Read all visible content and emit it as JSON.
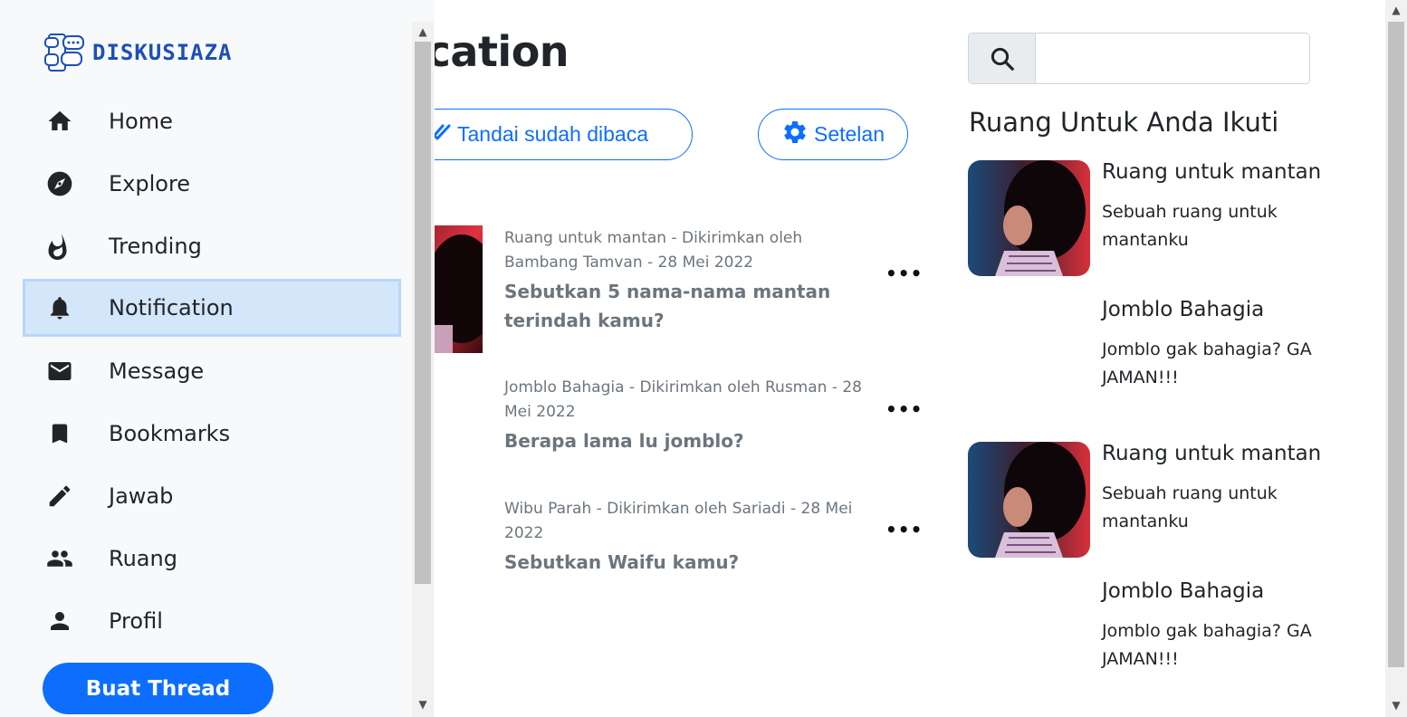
{
  "brand": {
    "name": "DISKUSIAZA"
  },
  "sidebar": {
    "items": [
      {
        "label": "Home",
        "icon": "home-icon"
      },
      {
        "label": "Explore",
        "icon": "compass-icon"
      },
      {
        "label": "Trending",
        "icon": "fire-icon"
      },
      {
        "label": "Notification",
        "icon": "bell-icon",
        "active": true
      },
      {
        "label": "Message",
        "icon": "mail-icon"
      },
      {
        "label": "Bookmarks",
        "icon": "bookmark-icon"
      },
      {
        "label": "Jawab",
        "icon": "pencil-icon"
      },
      {
        "label": "Ruang",
        "icon": "people-icon"
      },
      {
        "label": "Profil",
        "icon": "person-icon"
      }
    ],
    "create_button": "Buat Thread"
  },
  "main": {
    "title": "Notification",
    "mark_read_label": "Tandai sudah dibaca",
    "settings_label": "Setelan",
    "notifications": [
      {
        "meta": "Ruang untuk mantan - Dikirimkan oleh Bambang Tamvan - 28 Mei 2022",
        "question": "Sebutkan 5 nama-nama mantan terindah kamu?"
      },
      {
        "meta": "Jomblo Bahagia - Dikirimkan oleh Rusman - 28 Mei 2022",
        "question": "Berapa lama lu jomblo?"
      },
      {
        "meta": "Wibu Parah - Dikirimkan oleh Sariadi - 28 Mei 2022",
        "question": "Sebutkan Waifu kamu?"
      }
    ]
  },
  "right": {
    "search_placeholder": "",
    "title": "Ruang Untuk Anda Ikuti",
    "rooms": [
      {
        "name": "Ruang untuk mantan",
        "desc": "Sebuah ruang untuk mantanku"
      },
      {
        "name": "Jomblo Bahagia",
        "desc": "Jomblo gak bahagia? GA JAMAN!!!"
      },
      {
        "name": "Ruang untuk mantan",
        "desc": "Sebuah ruang untuk mantanku"
      },
      {
        "name": "Jomblo Bahagia",
        "desc": "Jomblo gak bahagia? GA JAMAN!!!"
      }
    ]
  },
  "colors": {
    "accent": "#0d6efd",
    "active_bg": "#d4e6f9",
    "brand": "#1d4fb8"
  }
}
